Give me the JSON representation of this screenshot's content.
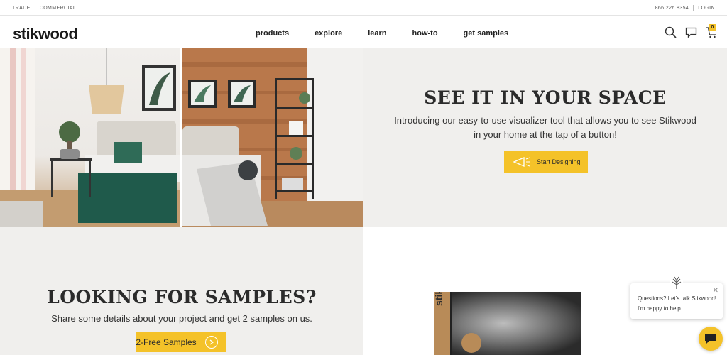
{
  "topbar": {
    "trade": "TRADE",
    "commercial": "COMMERCIAL",
    "phone": "866.226.8354",
    "login": "LOGIN"
  },
  "header": {
    "logo": "stikwood",
    "nav": [
      "products",
      "explore",
      "learn",
      "how-to",
      "get samples"
    ],
    "cart_count": "0",
    "icons": [
      "search-icon",
      "chat-bubble-icon",
      "cart-icon"
    ]
  },
  "hero": {
    "title": "SEE IT IN YOUR SPACE",
    "description": "Introducing our easy-to-use visualizer tool that allows you to see Stikwood in your home at the tap of a button!",
    "button_label": "Start Designing"
  },
  "samples": {
    "title": "LOOKING FOR SAMPLES?",
    "description": "Share some details about your project and get 2 samples on us.",
    "button_label": "2-Free Samples"
  },
  "product": {
    "box_text": "stikwoo"
  },
  "chat": {
    "line1": "Questions? Let's talk Stikwood!",
    "line2": "I'm happy to help.",
    "close": "✕"
  },
  "colors": {
    "accent": "#f4c229",
    "panel_bg": "#f0efed",
    "headline": "#2b2b2b"
  }
}
